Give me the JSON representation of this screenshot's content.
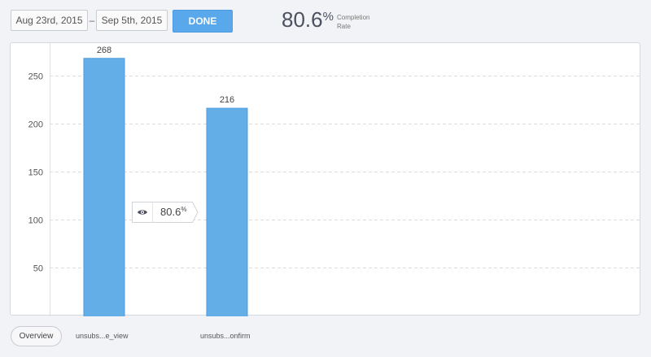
{
  "header": {
    "date_start": "Aug 23rd, 2015",
    "date_separator": "–",
    "date_end": "Sep 5th, 2015",
    "done_label": "DONE",
    "completion_value": "80.6",
    "completion_pct_sign": "%",
    "completion_label_line1": "Completion",
    "completion_label_line2": "Rate"
  },
  "callout": {
    "icon": "eye-icon",
    "value": "80.6",
    "pct_sign": "%"
  },
  "footer": {
    "overview_label": "Overview"
  },
  "colors": {
    "bar": "#64aee8",
    "accent": "#5aa8ec",
    "grid": "#dcdcdc"
  },
  "chart_data": {
    "type": "bar",
    "categories": [
      "unsubs...e_view",
      "unsubs...onfirm"
    ],
    "values": [
      268,
      216
    ],
    "data_labels": [
      "268",
      "216"
    ],
    "yticks": [
      50,
      100,
      150,
      200,
      250
    ],
    "ylim": [
      0,
      295
    ],
    "grid": true,
    "title": "",
    "xlabel": "",
    "ylabel": ""
  }
}
